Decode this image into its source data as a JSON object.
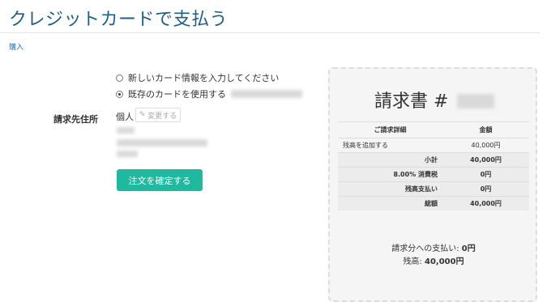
{
  "page": {
    "title": "クレジットカードで支払う",
    "breadcrumb": "購入"
  },
  "payment": {
    "option_new": "新しいカード情報を入力してください",
    "option_existing": "既存のカードを使用する",
    "selected": "existing"
  },
  "billing": {
    "label": "請求先住所",
    "name": "個人",
    "change_button": "変更する",
    "confirm_button": "注文を確定する"
  },
  "invoice": {
    "title_prefix": "請求書 #",
    "header_detail": "ご請求詳細",
    "header_amount": "金額",
    "rows": [
      {
        "label": "残高を追加する",
        "amount": "40,000円"
      },
      {
        "label": "小計",
        "amount": "40,000円"
      },
      {
        "label": "8.00% 消費税",
        "amount": "0円"
      },
      {
        "label": "残高支払い",
        "amount": "0円"
      },
      {
        "label": "総額",
        "amount": "40,000円"
      }
    ],
    "paid_label": "請求分への支払い:",
    "paid_value": "0円",
    "balance_label": "残高:",
    "balance_value": "40,000円"
  },
  "colors": {
    "title": "#1d5f8a",
    "link": "#1f73b7",
    "confirm_button": "#1fb99f"
  },
  "icons": {
    "change_button": "edit-icon"
  }
}
